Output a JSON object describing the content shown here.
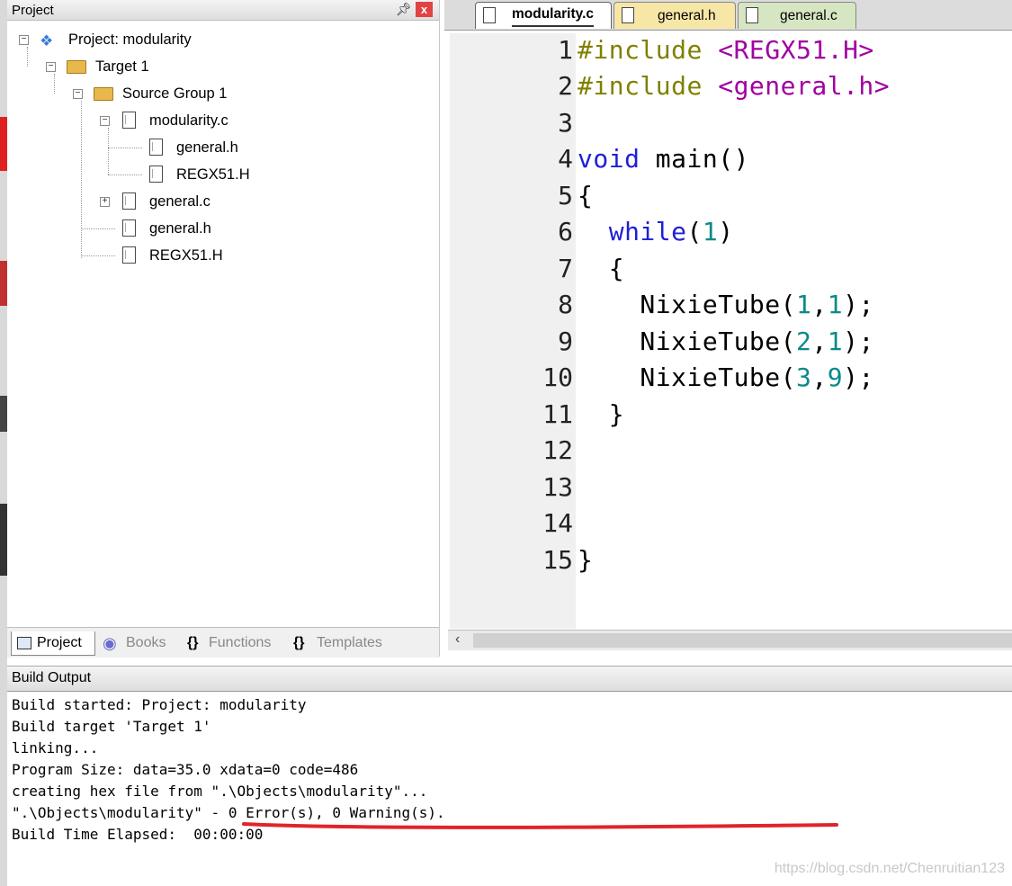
{
  "project_panel": {
    "title": "Project",
    "pin_icon": "pin-icon",
    "close_label": "x",
    "tree": [
      {
        "label": "Project: modularity",
        "icon": "project-icon",
        "toggle": "−"
      },
      {
        "label": "Target 1",
        "icon": "target-icon",
        "toggle": "−"
      },
      {
        "label": "Source Group 1",
        "icon": "folder-icon",
        "toggle": "−"
      },
      {
        "label": "modularity.c",
        "icon": "c-file-icon",
        "toggle": "−"
      },
      {
        "label": "general.h",
        "icon": "h-file-icon"
      },
      {
        "label": "REGX51.H",
        "icon": "h-file-icon"
      },
      {
        "label": "general.c",
        "icon": "c-file-icon",
        "toggle": "+"
      },
      {
        "label": "general.h",
        "icon": "h-file-icon"
      },
      {
        "label": "REGX51.H",
        "icon": "h-file-icon"
      }
    ],
    "tabs": [
      {
        "label": "Project",
        "icon": "project-tab-icon"
      },
      {
        "label": "Books",
        "icon": "books-icon"
      },
      {
        "label": "Functions",
        "icon": "braces-icon",
        "glyph": "{}"
      },
      {
        "label": "Templates",
        "icon": "templates-icon",
        "glyph": "{}"
      }
    ]
  },
  "editor": {
    "tabs": [
      {
        "label": "modularity.c",
        "active": true,
        "color": "#ffffff"
      },
      {
        "label": "general.h",
        "active": false,
        "color": "#f7e7a6"
      },
      {
        "label": "general.c",
        "active": false,
        "color": "#d6e6c3"
      }
    ],
    "line_numbers": [
      "1",
      "2",
      "3",
      "4",
      "5",
      "6",
      "7",
      "8",
      "9",
      "10",
      "11",
      "12",
      "13",
      "14",
      "15"
    ],
    "code": [
      [
        "#include ",
        "<REGX51.H>"
      ],
      [
        "#include ",
        "<general.h>"
      ],
      [],
      [
        "void",
        " main()"
      ],
      [
        "{"
      ],
      [
        "  ",
        "while",
        "(",
        "1",
        ")"
      ],
      [
        "  {"
      ],
      [
        "    NixieTube(",
        "1",
        ",",
        "1",
        ");"
      ],
      [
        "    NixieTube(",
        "2",
        ",",
        "1",
        ");"
      ],
      [
        "    NixieTube(",
        "3",
        ",",
        "9",
        ");"
      ],
      [
        "  }"
      ],
      [],
      [],
      [],
      [
        "}"
      ]
    ],
    "scroll_left_icon": "chevron-left-icon"
  },
  "build_output": {
    "title": "Build Output",
    "lines": [
      "Build started: Project: modularity",
      "Build target 'Target 1'",
      "linking...",
      "Program Size: data=35.0 xdata=0 code=486",
      "creating hex file from \".\\Objects\\modularity\"...",
      "\".\\Objects\\modularity\" - 0 Error(s), 0 Warning(s).",
      "Build Time Elapsed:  00:00:00"
    ],
    "annotation_color": "#e0242a"
  },
  "watermark": "https://blog.csdn.net/Chenruitian123",
  "colors": {
    "keyword": "#1f1fd6",
    "preprocessor": "#808000",
    "include_path": "#a000a0",
    "number": "#0a8a8a"
  }
}
